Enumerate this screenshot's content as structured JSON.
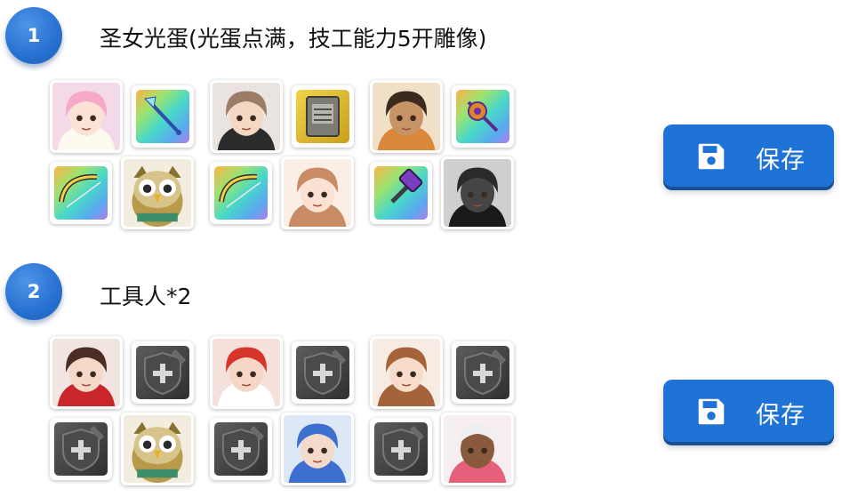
{
  "teams": [
    {
      "number": "1",
      "title": "圣女光蛋(光蛋点满，技工能力5开雕像)",
      "save_label": "保存",
      "pairs": [
        {
          "hero": {
            "icon": "saint-hero-portrait-icon",
            "bg": "#f4d9e8",
            "hair": "#f6a8c8",
            "skin": "#fde3d6",
            "hat": "#fffaf0"
          },
          "weapon": {
            "icon": "staff-weapon-icon",
            "kind": "staff",
            "frame": "rainbow"
          },
          "extra_hero": {
            "icon": "owl-hero-portrait-icon",
            "kind": "owl"
          },
          "extra_weapon": {
            "icon": "bow-weapon-icon",
            "kind": "bow",
            "frame": "rainbow"
          }
        },
        {
          "hero": {
            "icon": "knight-hero-portrait-icon",
            "bg": "#e9e4df",
            "hair": "#9b7c68",
            "skin": "#f4d8c4",
            "hat": "#2c2c2c"
          },
          "weapon": {
            "icon": "book-weapon-icon",
            "kind": "book",
            "frame": "gold"
          },
          "extra_hero": {
            "icon": "girl-hero-portrait-icon",
            "bg": "#fbeee6",
            "hair": "#c98b63",
            "skin": "#fbe1d2",
            "hat": "#c98b63"
          },
          "extra_weapon": {
            "icon": "bow-weapon-icon",
            "kind": "bow",
            "frame": "rainbow"
          }
        },
        {
          "hero": {
            "icon": "engineer-hero-portrait-icon",
            "bg": "#f1e0c8",
            "hair": "#3d2a1e",
            "skin": "#c89466",
            "hat": "#d9873a"
          },
          "weapon": {
            "icon": "mace-weapon-icon",
            "kind": "mace",
            "frame": "rainbow"
          },
          "extra_hero": {
            "icon": "beast-hero-portrait-icon",
            "bg": "#cfcfcf",
            "hair": "#2a2a2a",
            "skin": "#454545",
            "hat": "#1a1a1a"
          },
          "extra_weapon": {
            "icon": "hammer-weapon-icon",
            "kind": "hammer",
            "frame": "rainbow"
          }
        }
      ]
    },
    {
      "number": "2",
      "title": "工具人*2",
      "save_label": "保存",
      "pairs": [
        {
          "hero": {
            "icon": "scarf-hero-portrait-icon",
            "bg": "#f1e4e1",
            "hair": "#4b2d26",
            "skin": "#f4d8c8",
            "hat": "#c8262b"
          },
          "weapon": {
            "icon": "empty-shield-slot-icon",
            "kind": "empty",
            "frame": "empty"
          },
          "extra_hero": {
            "icon": "owl-hero-portrait-icon",
            "kind": "owl"
          },
          "extra_weapon": {
            "icon": "empty-shield-slot-icon",
            "kind": "empty",
            "frame": "empty"
          }
        },
        {
          "hero": {
            "icon": "red-hair-hero-portrait-icon",
            "bg": "#f5e0dc",
            "hair": "#d6352b",
            "skin": "#f6d7c6",
            "hat": "#ffffff"
          },
          "weapon": {
            "icon": "empty-shield-slot-icon",
            "kind": "empty",
            "frame": "empty"
          },
          "extra_hero": {
            "icon": "blue-hair-hero-portrait-icon",
            "bg": "#dde8f6",
            "hair": "#3c6fd0",
            "skin": "#f3dacb",
            "hat": "#3c6fd0"
          },
          "extra_weapon": {
            "icon": "empty-shield-slot-icon",
            "kind": "empty",
            "frame": "empty"
          }
        },
        {
          "hero": {
            "icon": "brown-hair-hero-portrait-icon",
            "bg": "#f6ece4",
            "hair": "#a5633a",
            "skin": "#f7dccb",
            "hat": "#a5633a"
          },
          "weapon": {
            "icon": "empty-shield-slot-icon",
            "kind": "empty",
            "frame": "empty"
          },
          "extra_hero": {
            "icon": "white-hair-hero-portrait-icon",
            "bg": "#f6eef0",
            "hair": "#f1eef1",
            "skin": "#8a5a3c",
            "hat": "#e6607a"
          },
          "extra_weapon": {
            "icon": "empty-shield-slot-icon",
            "kind": "empty",
            "frame": "empty"
          }
        }
      ]
    }
  ]
}
